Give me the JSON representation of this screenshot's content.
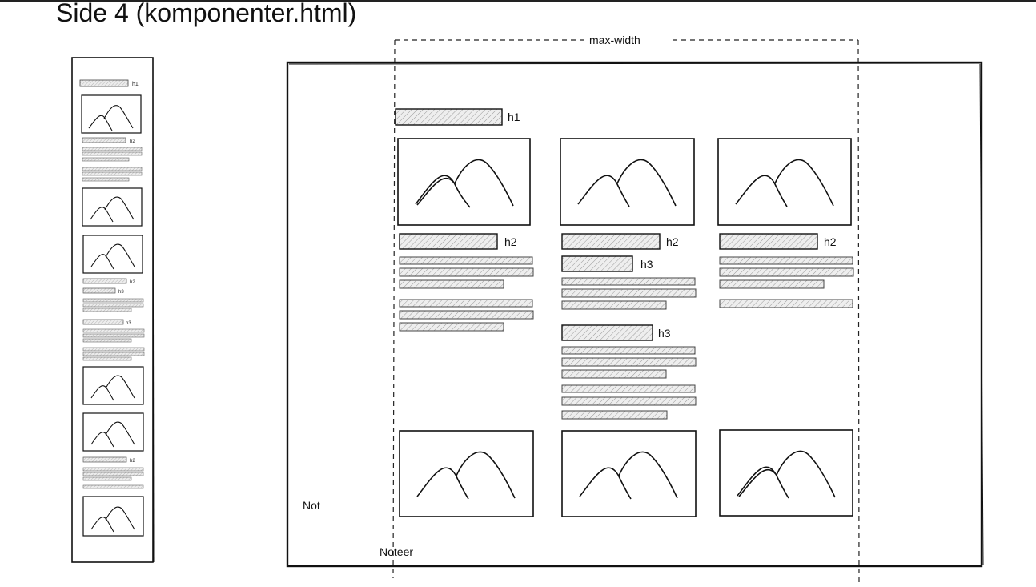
{
  "page_title": "Side 4 (komponenter.html)",
  "labels": {
    "max_width": "max-width",
    "h1": "h1",
    "h2": "h2",
    "h3": "h3",
    "note_left": "Not",
    "note_bottom": "Noteer"
  }
}
